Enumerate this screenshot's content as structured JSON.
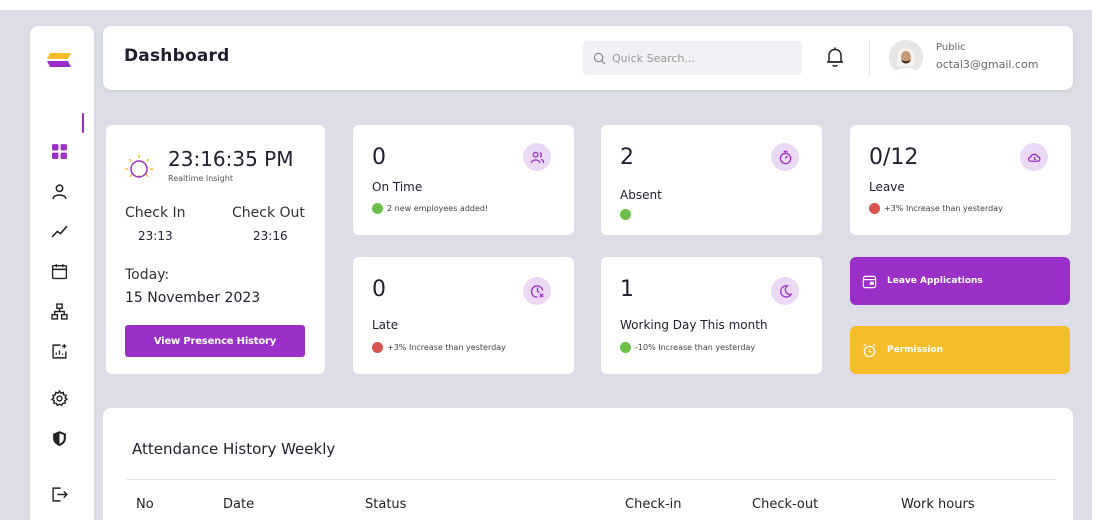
{
  "header": {
    "title": "Dashboard",
    "search_placeholder": "Quick Search...",
    "user": {
      "role": "Public",
      "email": "octal3@gmail.com"
    }
  },
  "sidebar": {
    "items": [
      {
        "icon": "grid-icon",
        "active": true
      },
      {
        "icon": "user-icon"
      },
      {
        "icon": "trend-icon"
      },
      {
        "icon": "calendar-icon"
      },
      {
        "icon": "org-chart-icon"
      },
      {
        "icon": "report-add-icon"
      },
      {
        "icon": "settings-icon"
      },
      {
        "icon": "shield-icon"
      },
      {
        "icon": "logout-icon"
      }
    ]
  },
  "clock": {
    "time": "23:16:35 PM",
    "subtitle": "Realtime Insight",
    "check_in_label": "Check In",
    "check_out_label": "Check Out",
    "check_in_value": "23:13",
    "check_out_value": "23:16",
    "today_label": "Today:",
    "today_value": "15 November 2023",
    "button_label": "View Presence History"
  },
  "stats": {
    "on_time": {
      "value": "0",
      "label": "On Time",
      "note": "2 new employees added!",
      "dot_color": "#6cc04a"
    },
    "absent": {
      "value": "2",
      "label": "Absent",
      "note": "",
      "dot_color": "#6cc04a"
    },
    "leave": {
      "value": "0/12",
      "label": "Leave",
      "note": "+3% Increase than yesterday",
      "dot_color": "#d9534f"
    },
    "late": {
      "value": "0",
      "label": "Late",
      "note": "+3% Increase than yesterday",
      "dot_color": "#d9534f"
    },
    "working_day": {
      "value": "1",
      "label": "Working Day This month",
      "note": "-10% Increase than yesterday",
      "dot_color": "#6cc04a"
    }
  },
  "actions": {
    "leave_applications": {
      "label": "Leave Applications",
      "color": "#9b30c8"
    },
    "permission": {
      "label": "Permission",
      "color": "#f6bd2b"
    }
  },
  "attendance": {
    "title": "Attendance History Weekly",
    "columns": [
      "No",
      "Date",
      "Status",
      "Check-in",
      "Check-out",
      "Work hours"
    ]
  },
  "colors": {
    "accent": "#9b30c8",
    "icon_bg": "#ead9f5",
    "background": "#dcdde6"
  }
}
